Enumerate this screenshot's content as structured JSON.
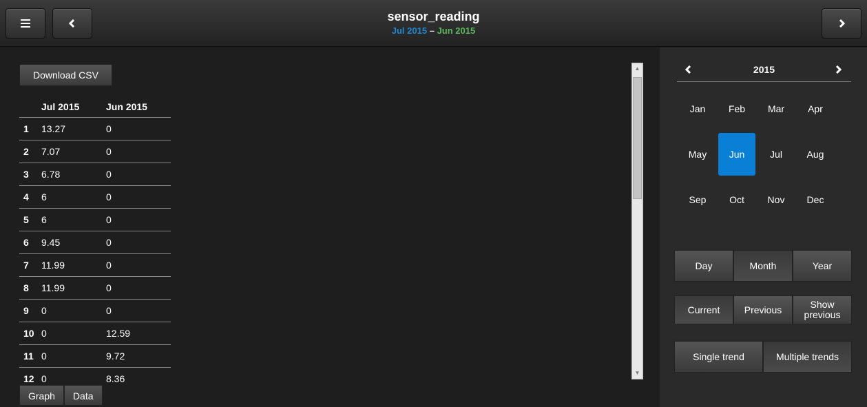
{
  "header": {
    "title": "sensor_reading",
    "range_start": "Jul 2015",
    "range_sep": " – ",
    "range_end": "Jun 2015",
    "menu_icon": "hamburger-icon",
    "back_icon": "chevron-left-icon",
    "forward_icon": "chevron-right-icon"
  },
  "main": {
    "download_label": "Download CSV",
    "table": {
      "col_a": "Jul 2015",
      "col_b": "Jun 2015",
      "rows": [
        {
          "idx": "1",
          "a": "13.27",
          "b": "0"
        },
        {
          "idx": "2",
          "a": "7.07",
          "b": "0"
        },
        {
          "idx": "3",
          "a": "6.78",
          "b": "0"
        },
        {
          "idx": "4",
          "a": "6",
          "b": "0"
        },
        {
          "idx": "5",
          "a": "6",
          "b": "0"
        },
        {
          "idx": "6",
          "a": "9.45",
          "b": "0"
        },
        {
          "idx": "7",
          "a": "11.99",
          "b": "0"
        },
        {
          "idx": "8",
          "a": "11.99",
          "b": "0"
        },
        {
          "idx": "9",
          "a": "0",
          "b": "0"
        },
        {
          "idx": "10",
          "a": "0",
          "b": "12.59"
        },
        {
          "idx": "11",
          "a": "0",
          "b": "9.72"
        },
        {
          "idx": "12",
          "a": "0",
          "b": "8.36"
        }
      ]
    },
    "tabs": [
      "Graph",
      "Data"
    ]
  },
  "side": {
    "year": "2015",
    "months": [
      "Jan",
      "Feb",
      "Mar",
      "Apr",
      "May",
      "Jun",
      "Jul",
      "Aug",
      "Sep",
      "Oct",
      "Nov",
      "Dec"
    ],
    "active_month": "Jun",
    "period_buttons": [
      "Day",
      "Month",
      "Year"
    ],
    "compare_buttons": [
      "Current",
      "Previous",
      "Show previous"
    ],
    "trend_buttons": [
      "Single trend",
      "Multiple trends"
    ],
    "accent_color": "#0a7fd6",
    "range_start_color": "#1e88d0",
    "range_end_color": "#5cb85c"
  }
}
